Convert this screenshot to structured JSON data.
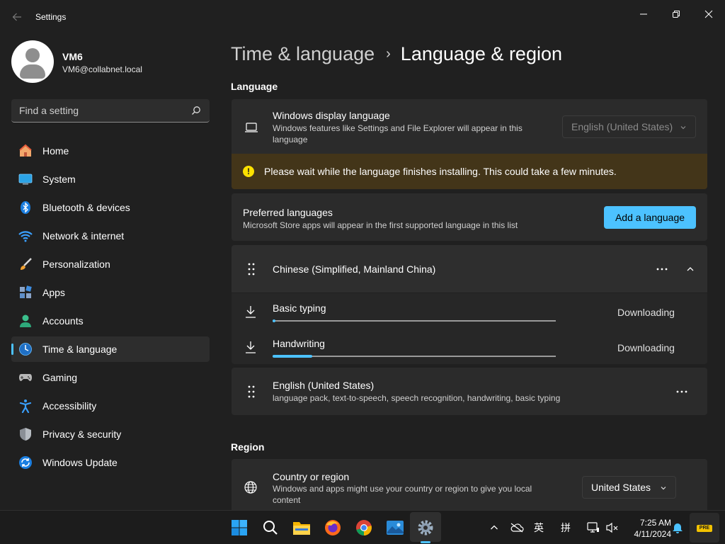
{
  "app": {
    "title": "Settings"
  },
  "profile": {
    "name": "VM6",
    "email": "VM6@collabnet.local"
  },
  "search": {
    "placeholder": "Find a setting"
  },
  "sidebar": {
    "items": [
      {
        "label": "Home",
        "icon": "home-icon"
      },
      {
        "label": "System",
        "icon": "system-icon"
      },
      {
        "label": "Bluetooth & devices",
        "icon": "bluetooth-icon"
      },
      {
        "label": "Network & internet",
        "icon": "network-icon"
      },
      {
        "label": "Personalization",
        "icon": "personalization-brush-icon"
      },
      {
        "label": "Apps",
        "icon": "apps-icon"
      },
      {
        "label": "Accounts",
        "icon": "accounts-icon"
      },
      {
        "label": "Time & language",
        "icon": "time-language-icon",
        "active": true
      },
      {
        "label": "Gaming",
        "icon": "gaming-controller-icon"
      },
      {
        "label": "Accessibility",
        "icon": "accessibility-icon"
      },
      {
        "label": "Privacy & security",
        "icon": "shield-icon"
      },
      {
        "label": "Windows Update",
        "icon": "windows-update-icon"
      }
    ]
  },
  "breadcrumb": {
    "parent": "Time & language",
    "separator": "›",
    "current": "Language & region"
  },
  "language_section": {
    "title": "Language",
    "display_language": {
      "title": "Windows display language",
      "description": "Windows features like Settings and File Explorer will appear in this language",
      "value": "English (United States)"
    },
    "warning": "Please wait while the language finishes installing. This could take a few minutes.",
    "preferred": {
      "title": "Preferred languages",
      "description": "Microsoft Store apps will appear in the first supported language in this list",
      "add_button": "Add a language"
    },
    "languages": [
      {
        "name": "Chinese (Simplified, Mainland China)",
        "features": [
          {
            "name": "Basic typing",
            "status": "Downloading",
            "progress": 0.01
          },
          {
            "name": "Handwriting",
            "status": "Downloading",
            "progress": 0.14
          }
        ]
      },
      {
        "name": "English (United States)",
        "description": "language pack, text-to-speech, speech recognition, handwriting, basic typing"
      }
    ]
  },
  "region_section": {
    "title": "Region",
    "country": {
      "title": "Country or region",
      "description": "Windows and apps might use your country or region to give you local content",
      "value": "United States"
    }
  },
  "taskbar": {
    "time": "7:25 AM",
    "date": "4/11/2024",
    "ime_lang": "英",
    "ime_mode": "拼",
    "badge": "PRE"
  },
  "colors": {
    "accent": "#4cc2ff",
    "background": "#202020",
    "card": "#2b2b2b",
    "warning_bg": "#433519",
    "warning_icon": "#fce100"
  }
}
